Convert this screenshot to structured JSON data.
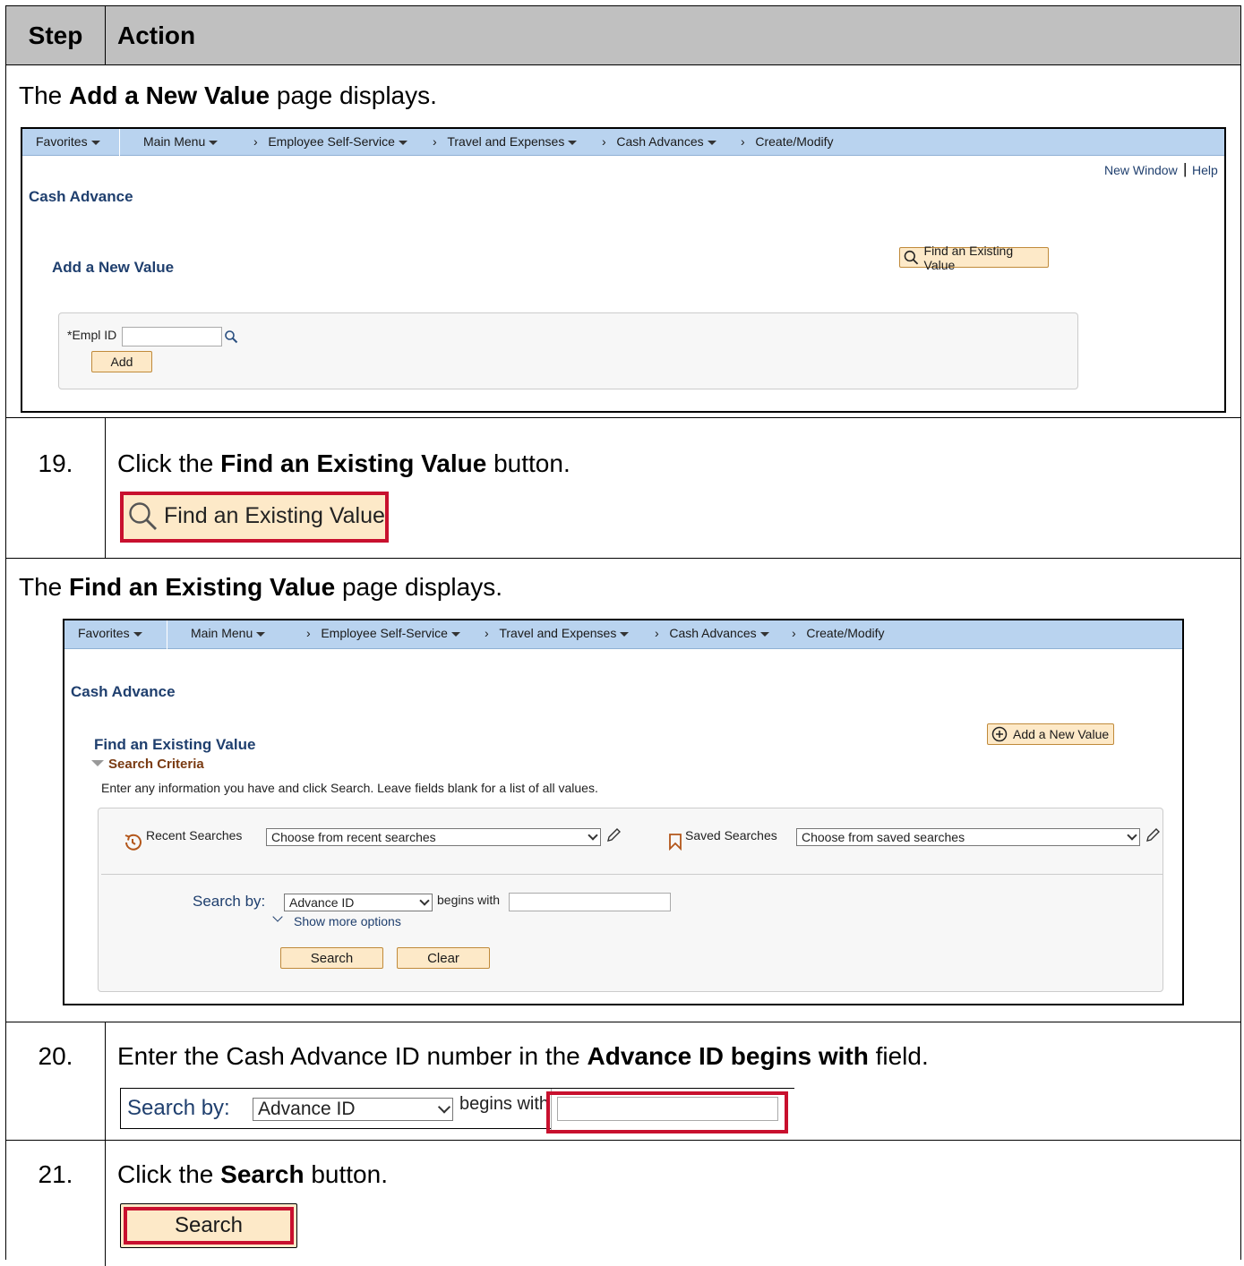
{
  "header": {
    "step": "Step",
    "action": "Action"
  },
  "blocks": {
    "add_intro": {
      "pre": "The ",
      "bold": "Add a New Value",
      "post": " page displays."
    },
    "find_intro": {
      "pre": "The ",
      "bold": "Find an Existing Value",
      "post": " page displays."
    }
  },
  "steps": [
    {
      "num": "19.",
      "pre": "Click the ",
      "bold": "Find an Existing Value",
      "post": " button."
    },
    {
      "num": "20.",
      "pre": "Enter the Cash Advance ID number in the ",
      "bold": "Advance ID begins with",
      "post": " field."
    },
    {
      "num": "21.",
      "pre": "Click the ",
      "bold": "Search",
      "post": " button."
    }
  ],
  "nav": {
    "favorites": "Favorites",
    "main_menu": "Main Menu",
    "ess": "Employee Self-Service",
    "travel": "Travel and Expenses",
    "cash_adv": "Cash Advances",
    "create": "Create/Modify"
  },
  "screen_add": {
    "new_window": "New Window",
    "help": "Help",
    "title": "Cash Advance",
    "subtitle": "Add a New Value",
    "find_btn": "Find an Existing Value",
    "empl_label": "*Empl ID",
    "add_btn": "Add"
  },
  "screen_find": {
    "title": "Cash Advance",
    "subtitle": "Find an Existing Value",
    "add_btn": "Add a New Value",
    "criteria": "Search Criteria",
    "instructions": "Enter any information you have and click Search. Leave fields blank for a list of all values.",
    "recent_label": "Recent Searches",
    "recent_value": "Choose from recent searches",
    "saved_label": "Saved Searches",
    "saved_value": "Choose from saved searches",
    "search_by": "Search by:",
    "search_field": "Advance ID",
    "begins_with": "begins with",
    "show_more": "Show more options",
    "search_btn": "Search",
    "clear_btn": "Clear"
  },
  "crops": {
    "find_btn": "Find an Existing Value",
    "search_by": "Search by:",
    "search_field": "Advance ID",
    "begins_with": "begins with",
    "search_btn": "Search"
  },
  "colors": {
    "highlight": "#c8102e",
    "nav_bg": "#b9d3ef",
    "button_bg": "#fde9c8",
    "title": "#1f3f6e"
  }
}
